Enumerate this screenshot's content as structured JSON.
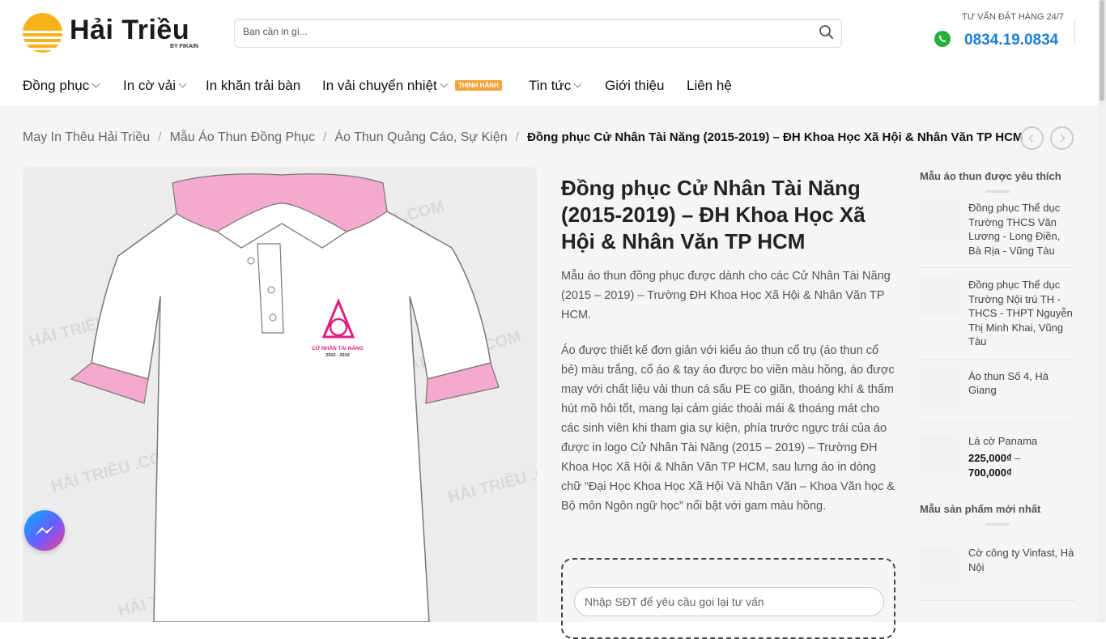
{
  "header": {
    "logo": {
      "brand": "Hải Triều",
      "tagline": "BY FIKAIN"
    },
    "search": {
      "placeholder": "Bạn cần in gì..."
    },
    "hotline": {
      "label": "TƯ VẤN ĐẶT HÀNG 24/7",
      "number": "0834.19.0834",
      "icon": "phone-whatsapp-icon"
    }
  },
  "nav": {
    "items": [
      {
        "label": "Đồng phục",
        "has_dropdown": true
      },
      {
        "label": "In cờ vải",
        "has_dropdown": true
      },
      {
        "label": "In khăn trải bàn",
        "has_dropdown": false
      },
      {
        "label": "In vải chuyển nhiệt",
        "has_dropdown": true,
        "badge": "THỊNH HÀNH"
      },
      {
        "label": "Tin tức",
        "has_dropdown": true
      },
      {
        "label": "Giới thiệu",
        "has_dropdown": false
      },
      {
        "label": "Liên hệ",
        "has_dropdown": false
      }
    ],
    "badge_color": "#f3a638"
  },
  "breadcrumb": {
    "items": [
      "May In Thêu Hải Triều",
      "Mẫu Áo Thun Đồng Phục",
      "Áo Thun Quảng Cáo, Sự Kiện"
    ],
    "current": "Đồng phục Cử Nhân Tài Năng (2015-2019) – ĐH Khoa Học Xã Hội & Nhân Văn TP HCM",
    "sep": "/"
  },
  "product": {
    "title": "Đồng phục Cử Nhân Tài Năng (2015-2019) – ĐH Khoa Học Xã Hội & Nhân Văn TP HCM",
    "image_logo_text": "CỬ NHÂN TÀI NĂNG",
    "image_logo_years": "2015 - 2019",
    "watermark": "HẢI TRIỀU .COM",
    "desc_1": "Mẫu áo thun đồng phục được dành cho các Cử Nhân Tài Năng (2015 – 2019) – Trường ĐH Khoa Học Xã Hội & Nhân Văn TP HCM.",
    "desc_2": "Áo được thiết kế đơn giản với kiểu áo thun cổ trụ (áo thun cổ bẻ) màu trắng, cổ áo & tay áo được bo viền màu hồng, áo được may với chất liệu vải thun cá sấu PE co giãn, thoáng khí & thấm hút mồ hôi tốt, mang lại cảm giác thoải mái & thoáng mát cho các sinh viên khi tham gia sự kiện, phía trước ngực trái của áo được in logo Cử Nhân Tài Năng (2015 – 2019) – Trường ĐH Khoa Học Xã Hội & Nhân Văn TP HCM, sau lưng áo in dòng chữ “Đại Học Khoa Học Xã Hội Và Nhân Văn – Khoa Văn học & Bộ môn Ngôn ngữ học” nổi bật với gam màu hồng.",
    "callback_placeholder": "Nhập SĐT để yêu cầu gọi lại tư vấn",
    "accent_pink": "#f4a9cf",
    "logo_magenta": "#e0207f"
  },
  "sidebar": {
    "popular_title": "Mẫu áo thun được yêu thích",
    "popular": [
      {
        "name": "Đồng phục Thể dục Trường THCS Văn Lương - Long Điền, Bà Rịa - Vũng Tàu"
      },
      {
        "name": "Đồng phục Thể dục Trường Nội trú TH - THCS - THPT Nguyễn Thị Minh Khai, Vũng Tàu"
      },
      {
        "name": "Áo thun Số 4, Hà Giang"
      },
      {
        "name": "Lá cờ Panama",
        "price_min": "225,000₫",
        "price_sep": "–",
        "price_max": "700,000₫"
      }
    ],
    "latest_title": "Mẫu sản phẩm mới nhất",
    "latest": [
      {
        "name": "Cờ công ty Vinfast, Hà Nội"
      }
    ]
  },
  "floating": {
    "messenger_icon": "messenger-icon"
  }
}
